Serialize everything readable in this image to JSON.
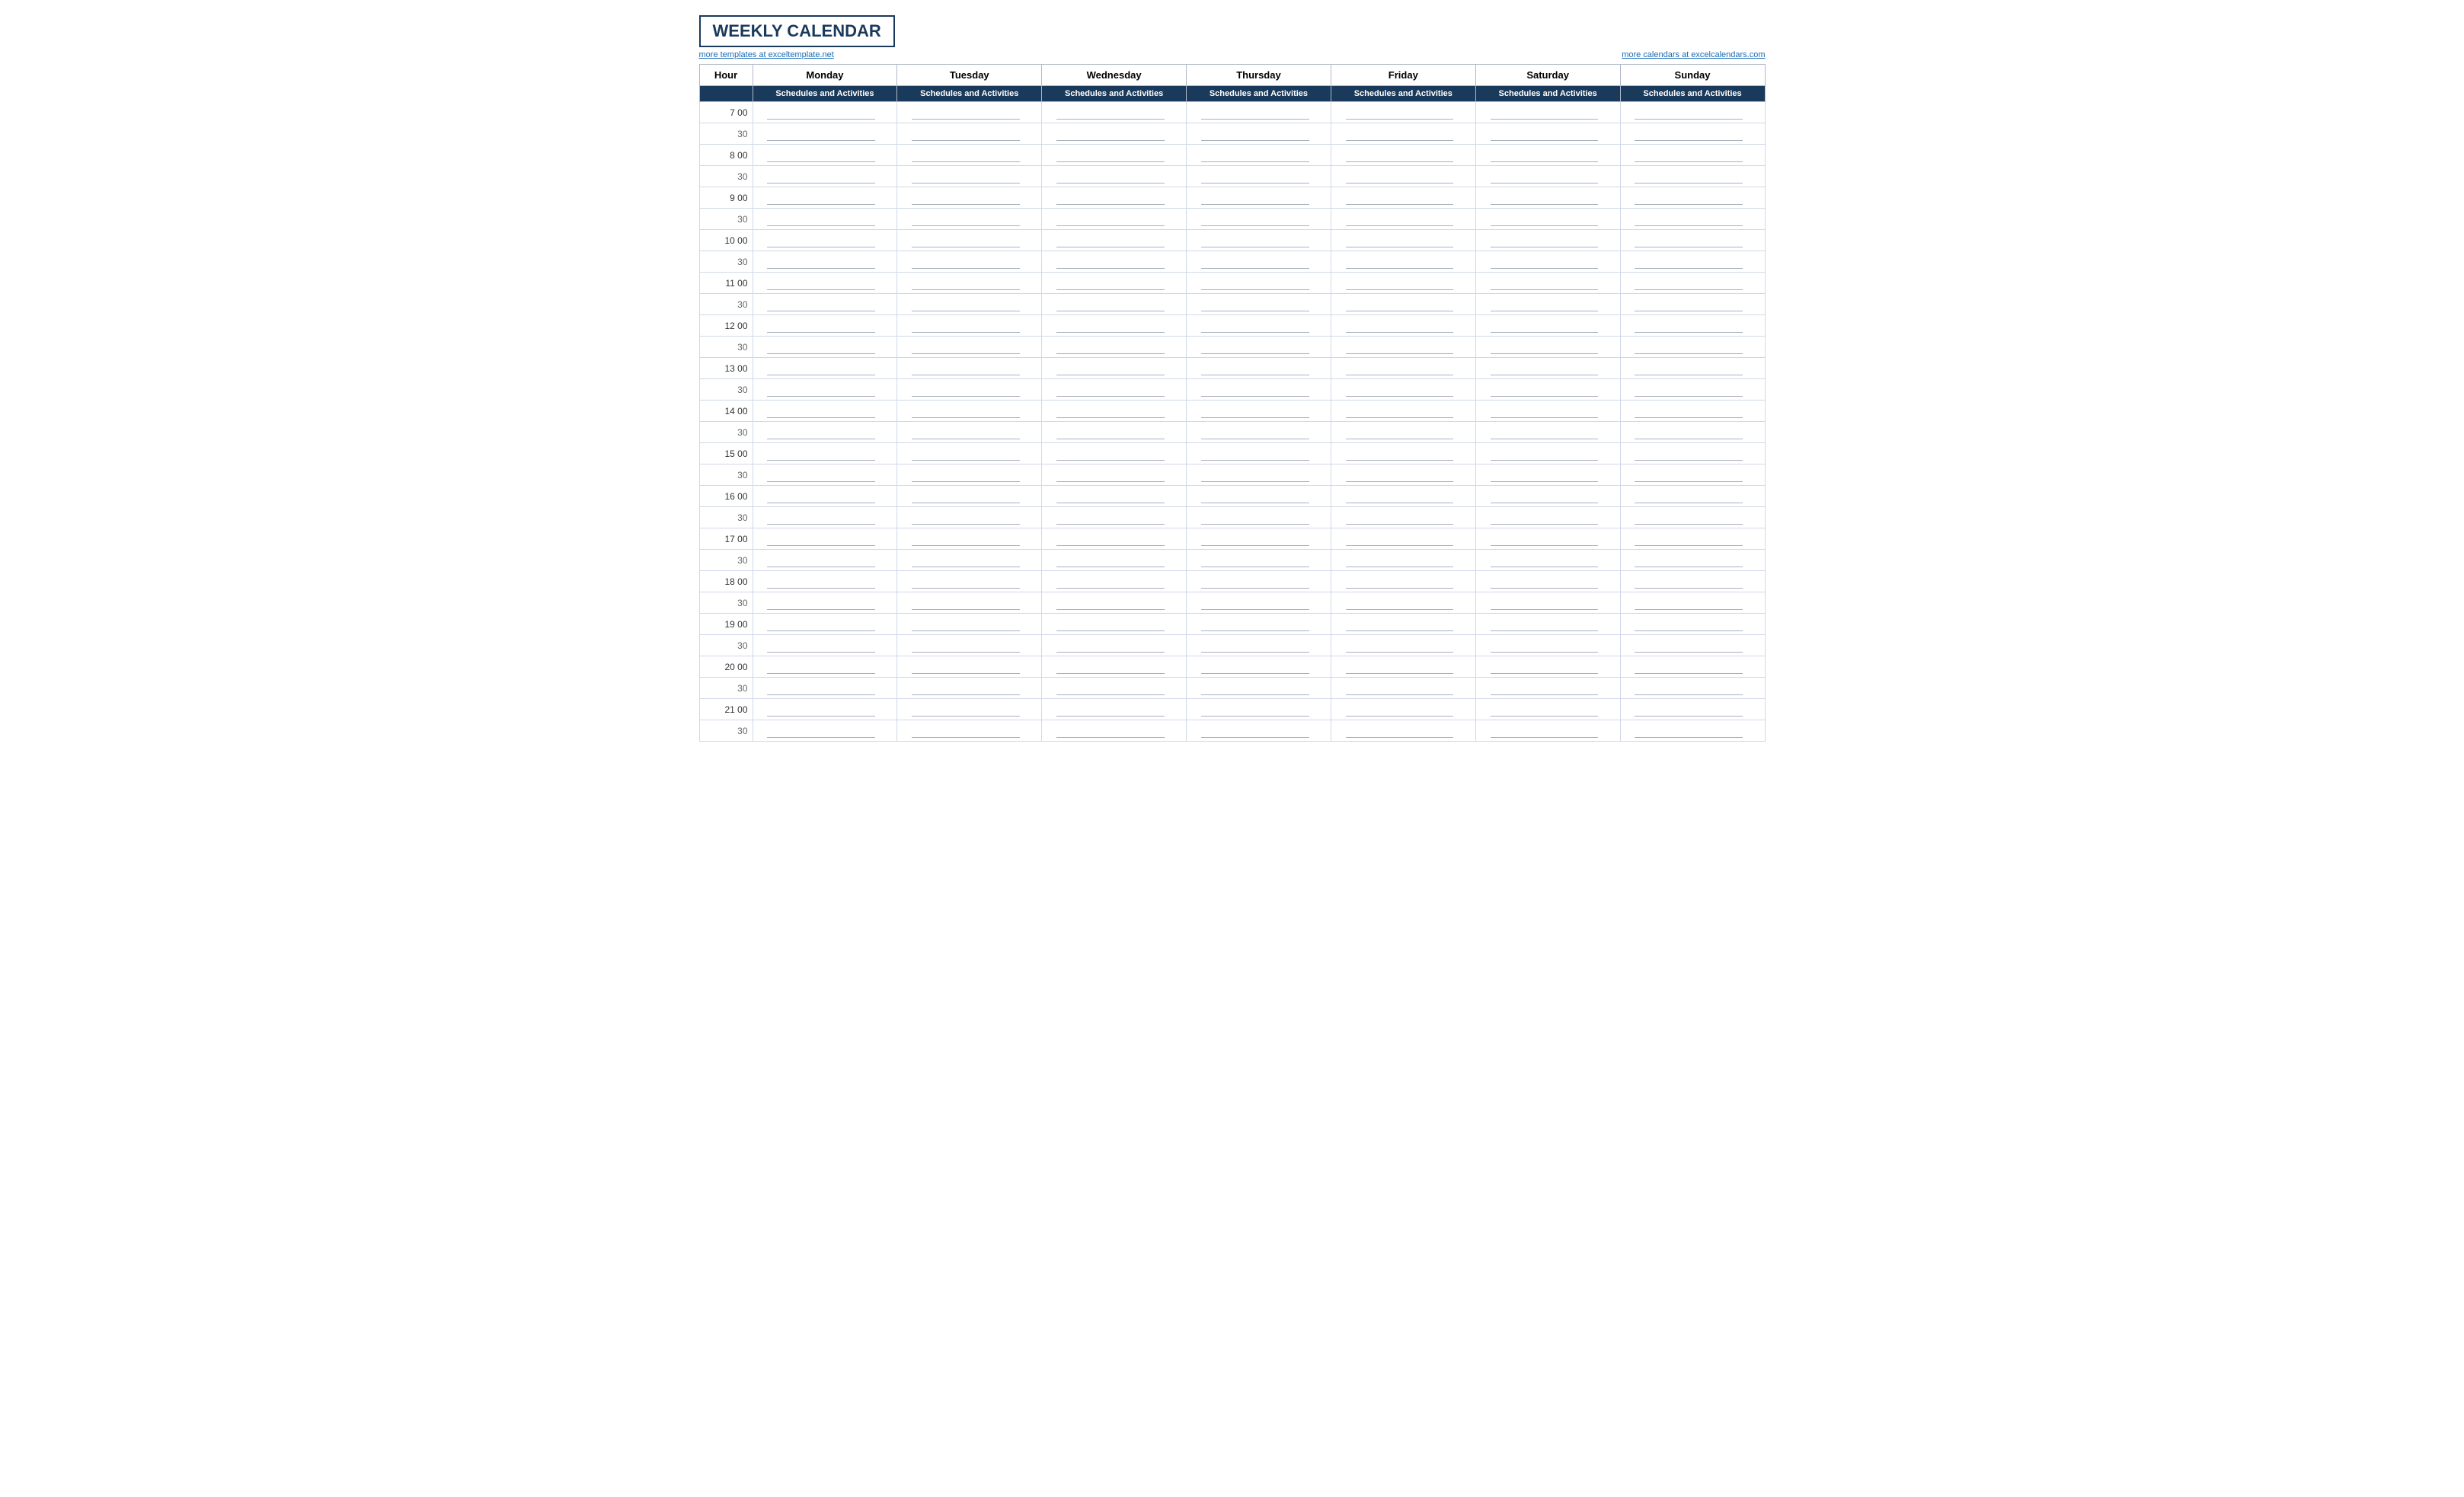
{
  "title": "WEEKLY CALENDAR",
  "links": {
    "left": "more templates at exceltemplate.net",
    "right": "more calendars at excelcalendars.com"
  },
  "header": {
    "hour_label": "Hour",
    "days": [
      "Monday",
      "Tuesday",
      "Wednesday",
      "Thursday",
      "Friday",
      "Saturday",
      "Sunday"
    ],
    "sub_label": "Schedules and Activities"
  },
  "time_slots": [
    {
      "hour": "7  00",
      "half": "30"
    },
    {
      "hour": "8  00",
      "half": "30"
    },
    {
      "hour": "9  00",
      "half": "30"
    },
    {
      "hour": "10  00",
      "half": "30"
    },
    {
      "hour": "11  00",
      "half": "30"
    },
    {
      "hour": "12  00",
      "half": "30"
    },
    {
      "hour": "13  00",
      "half": "30"
    },
    {
      "hour": "14  00",
      "half": "30"
    },
    {
      "hour": "15  00",
      "half": "30"
    },
    {
      "hour": "16  00",
      "half": "30"
    },
    {
      "hour": "17  00",
      "half": "30"
    },
    {
      "hour": "18  00",
      "half": "30"
    },
    {
      "hour": "19  00",
      "half": "30"
    },
    {
      "hour": "20  00",
      "half": "30"
    },
    {
      "hour": "21  00",
      "half": "30"
    }
  ],
  "colors": {
    "title_color": "#1a3a5c",
    "header_bg": "#1a3a5c",
    "header_text": "#ffffff",
    "border": "#b0b8c8",
    "link": "#1a6bb5"
  }
}
